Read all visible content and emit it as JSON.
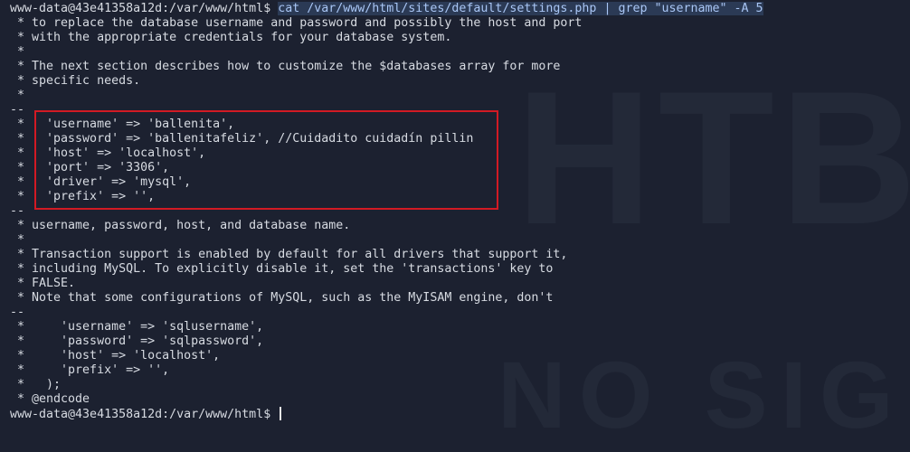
{
  "terminal": {
    "prompt": "www-data@43e41358a12d:/var/www/html$ ",
    "command": "cat /var/www/html/sites/default/settings.php | grep \"username\" -A 5",
    "output_lines": [
      " * to replace the database username and password and possibly the host and port",
      " * with the appropriate credentials for your database system.",
      " *",
      " * The next section describes how to customize the $databases array for more",
      " * specific needs.",
      " *",
      "--",
      " *   'username' => 'ballenita',",
      " *   'password' => 'ballenitafeliz', //Cuidadito cuidadín pillin",
      " *   'host' => 'localhost',",
      " *   'port' => '3306',",
      " *   'driver' => 'mysql',",
      " *   'prefix' => '',",
      "--",
      " * username, password, host, and database name.",
      " *",
      " * Transaction support is enabled by default for all drivers that support it,",
      " * including MySQL. To explicitly disable it, set the 'transactions' key to",
      " * FALSE.",
      " * Note that some configurations of MySQL, such as the MyISAM engine, don't",
      "--",
      " *     'username' => 'sqlusername',",
      " *     'password' => 'sqlpassword',",
      " *     'host' => 'localhost',",
      " *     'prefix' => '',",
      " *   );",
      " * @endcode"
    ],
    "final_prompt": "www-data@43e41358a12d:/var/www/html$ "
  },
  "watermark": {
    "big": "HTB",
    "small": "NO SIG"
  },
  "colors": {
    "background": "#1c2130",
    "command_highlight": "#2b3a55",
    "annotation_box": "#d21a24"
  }
}
